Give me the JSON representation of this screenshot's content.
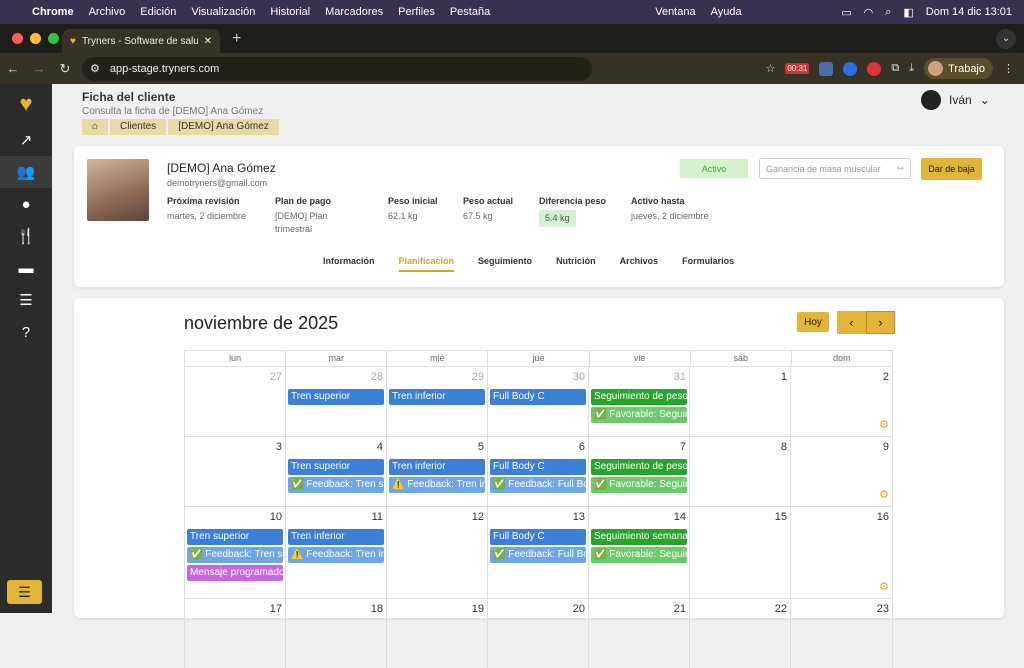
{
  "menubar": {
    "app": "Chrome",
    "items": [
      "Archivo",
      "Edición",
      "Visualización",
      "Historial",
      "Marcadores",
      "Perfiles",
      "Pestaña",
      "Ventana",
      "Ayuda"
    ],
    "clock": "Dom 14 dic 13:01"
  },
  "browser": {
    "tab_title": "Tryners - Software de salud p",
    "url": "app-stage.tryners.com",
    "profile": "Trabajo",
    "ext_badge": "00:31"
  },
  "header": {
    "title": "Ficha del cliente",
    "subtitle": "Consulta la ficha de [DEMO] Ana Gómez",
    "crumbs": [
      "Clientes",
      "[DEMO] Ana Gómez"
    ],
    "user": "Iván"
  },
  "client": {
    "name": "[DEMO] Ana Gómez",
    "email": "demotryners@gmail.com",
    "status": "Activo",
    "goal": "Ganancia de masa muscular",
    "dismiss": "Dar de baja",
    "fields": [
      {
        "label": "Próxima revisión",
        "value": "martes, 2 diciembre"
      },
      {
        "label": "Plan de pago",
        "value": "[DEMO] Plan trimestral"
      },
      {
        "label": "Peso inicial",
        "value": "62.1 kg"
      },
      {
        "label": "Peso actual",
        "value": "67.5 kg"
      },
      {
        "label": "Diferencia peso",
        "value": "5.4 kg"
      },
      {
        "label": "Activo hasta",
        "value": "jueves, 2 diciembre"
      }
    ]
  },
  "tabs": [
    "Información",
    "Planificación",
    "Seguimiento",
    "Nutrición",
    "Archivos",
    "Formularios"
  ],
  "calendar": {
    "month": "noviembre de 2025",
    "today": "Hoy",
    "prev": "‹",
    "next": "›",
    "dow": [
      "lun",
      "mar",
      "mié",
      "jue",
      "vie",
      "sáb",
      "dom"
    ],
    "weeks": [
      {
        "days": [
          "27",
          "28",
          "29",
          "30",
          "31",
          "1",
          "2"
        ],
        "out": [
          true,
          true,
          true,
          true,
          true,
          false,
          false
        ]
      },
      {
        "days": [
          "3",
          "4",
          "5",
          "6",
          "7",
          "8",
          "9"
        ],
        "out": [
          false,
          false,
          false,
          false,
          false,
          false,
          false
        ]
      },
      {
        "days": [
          "10",
          "11",
          "12",
          "13",
          "14",
          "15",
          "16"
        ],
        "out": [
          false,
          false,
          false,
          false,
          false,
          false,
          false
        ]
      },
      {
        "days": [
          "17",
          "18",
          "19",
          "20",
          "21",
          "22",
          "23"
        ],
        "out": [
          false,
          false,
          false,
          false,
          false,
          false,
          false
        ]
      }
    ],
    "events": {
      "w0": [
        "Tren superior",
        "Tren inferior",
        "Full Body C",
        "Seguimiento de peso y",
        "✅ Favorable: Seguimie"
      ],
      "w1": [
        "Tren superior",
        "✅ Feedback: Tren sup",
        "Tren inferior",
        "⚠️ Feedback: Tren infe",
        "Full Body C",
        "✅ Feedback: Full Body",
        "Seguimiento de peso y",
        "✅ Favorable: Seguimie"
      ],
      "w2": [
        "Tren superior",
        "✅ Feedback: Tren sup",
        "Mensaje programado",
        "Tren inferior",
        "⚠️ Feedback: Tren infe",
        "Full Body C",
        "✅ Feedback: Full Body",
        "Seguimiento semanal",
        "✅ Favorable: Seguimie"
      ]
    }
  }
}
